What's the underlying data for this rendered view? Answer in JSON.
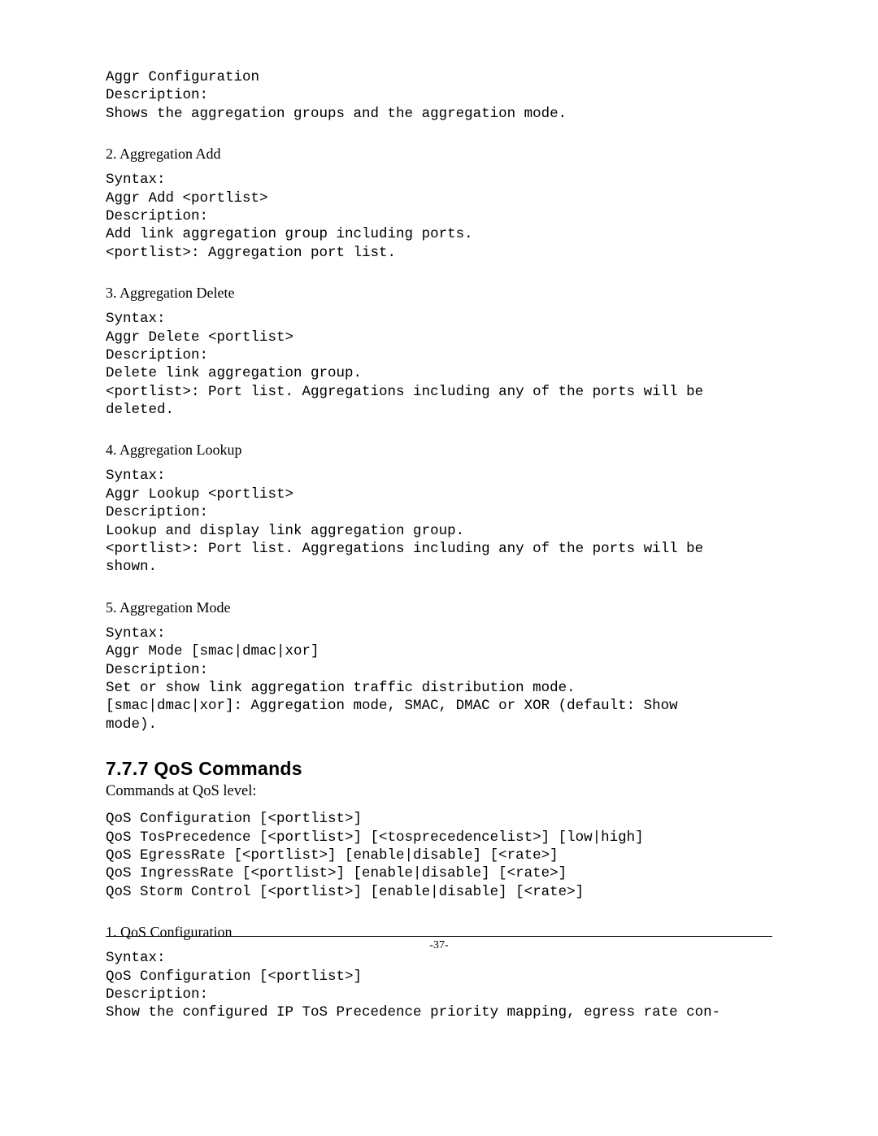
{
  "block1": "Aggr Configuration\nDescription:\nShows the aggregation groups and the aggregation mode.",
  "h2": "2.  Aggregation Add",
  "block2": "Syntax:\nAggr Add <portlist>\nDescription:\nAdd link aggregation group including ports.\n<portlist>: Aggregation port list.",
  "h3": "3.  Aggregation Delete",
  "block3": "Syntax:\nAggr Delete <portlist>\nDescription:\nDelete link aggregation group.\n<portlist>: Port list. Aggregations including any of the ports will be\ndeleted.",
  "h4": "4.  Aggregation Lookup",
  "block4": "Syntax:\nAggr Lookup <portlist>\nDescription:\nLookup and display link aggregation group.\n<portlist>: Port list. Aggregations including any of the ports will be\nshown.",
  "h5": "5.  Aggregation Mode",
  "block5": "Syntax:\nAggr Mode [smac|dmac|xor]\nDescription:\nSet or show link aggregation traffic distribution mode.\n[smac|dmac|xor]: Aggregation mode, SMAC, DMAC or XOR (default: Show\nmode).",
  "sectionTitle": "7.7.7 QoS Commands",
  "sectionIntro": "Commands at QoS level:",
  "block6": "QoS Configuration [<portlist>]\nQoS TosPrecedence [<portlist>] [<tosprecedencelist>] [low|high]\nQoS EgressRate [<portlist>] [enable|disable] [<rate>]\nQoS IngressRate [<portlist>] [enable|disable] [<rate>]\nQoS Storm Control [<portlist>] [enable|disable] [<rate>]",
  "h6": "1.  QoS Configuration",
  "block7": "Syntax:\nQoS Configuration [<portlist>]\nDescription:\nShow the configured IP ToS Precedence priority mapping, egress rate con-",
  "pageNumber": "-37-"
}
